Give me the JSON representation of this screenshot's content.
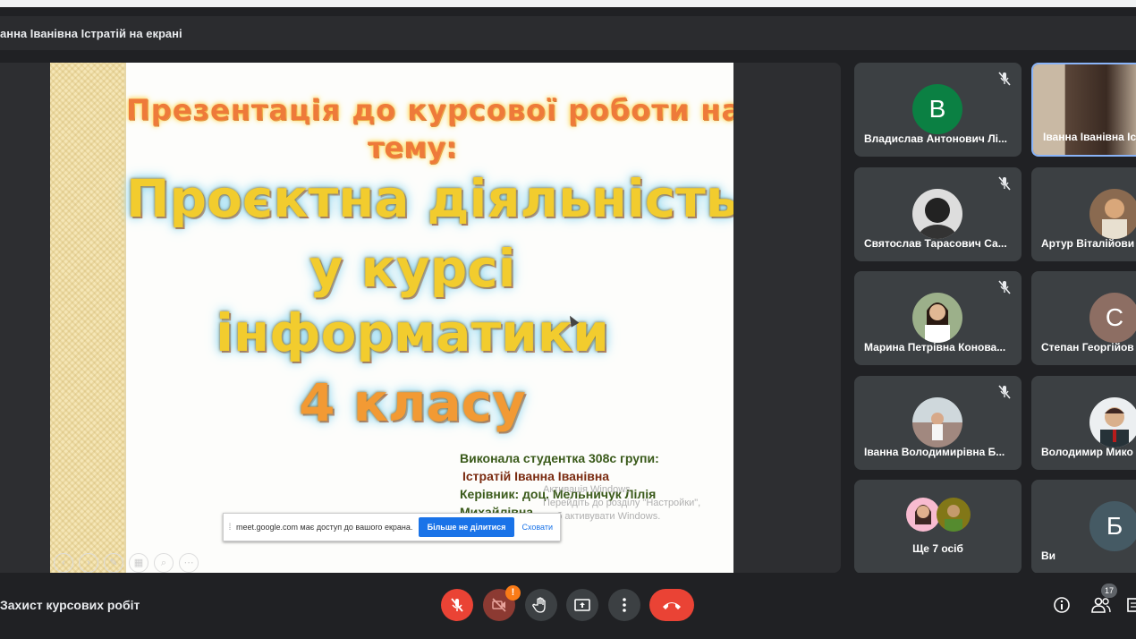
{
  "presenting_banner": "анна Іванівна Істратій на екрані",
  "slide": {
    "title_line1": "Презентація до курсової роботи на",
    "title_line2": "тему:",
    "topic_line1": "Проєктна діяльність",
    "topic_line2": "у курсі",
    "topic_line3": "інформатики",
    "topic_line4": "4 класу",
    "author_label": "Виконала студентка 308с групи:",
    "author_name": "Істратій Іванна Іванівна",
    "supervisor_line": "Керівник: доц. Мельничук Лілія",
    "supervisor_line2": "Михайлівна",
    "watermark_line1": "Активація Windows",
    "watermark_line2": "Перейдіть до розділу \"Настройки\",",
    "watermark_line3": "щоб активувати Windows."
  },
  "share_bar": {
    "message": "meet.google.com має доступ до вашого екрана.",
    "stop_label": "Більше не ділитися",
    "hide_label": "Сховати"
  },
  "participants": [
    {
      "name": "Владислав Антонович Лі...",
      "initial": "В",
      "color": "#0b8043",
      "muted": true
    },
    {
      "name": "Іванна Іванівна Іс",
      "initial": "",
      "color": "#6d5a4a",
      "muted": false
    },
    {
      "name": "Святослав Тарасович Са...",
      "initial": "",
      "color": "#555",
      "muted": true
    },
    {
      "name": "Артур Віталійови",
      "initial": "",
      "color": "#8a6a50",
      "muted": false
    },
    {
      "name": "Марина Петрівна Конова...",
      "initial": "",
      "color": "#7a8a6a",
      "muted": true
    },
    {
      "name": "Степан Георгійов",
      "initial": "С",
      "color": "#8d6e63",
      "muted": false
    },
    {
      "name": "Іванна Володимирівна Б...",
      "initial": "",
      "color": "#8a7a6a",
      "muted": true
    },
    {
      "name": "Володимир Мико",
      "initial": "",
      "color": "#6a6a7a",
      "muted": false
    }
  ],
  "more_tile": {
    "label": "Ще 7 осіб"
  },
  "self_tile": {
    "name": "Ви",
    "initial": "Б",
    "color": "#455a64"
  },
  "meeting_name": "Захист курсових робіт",
  "participant_count": "17",
  "camera_badge": "!"
}
